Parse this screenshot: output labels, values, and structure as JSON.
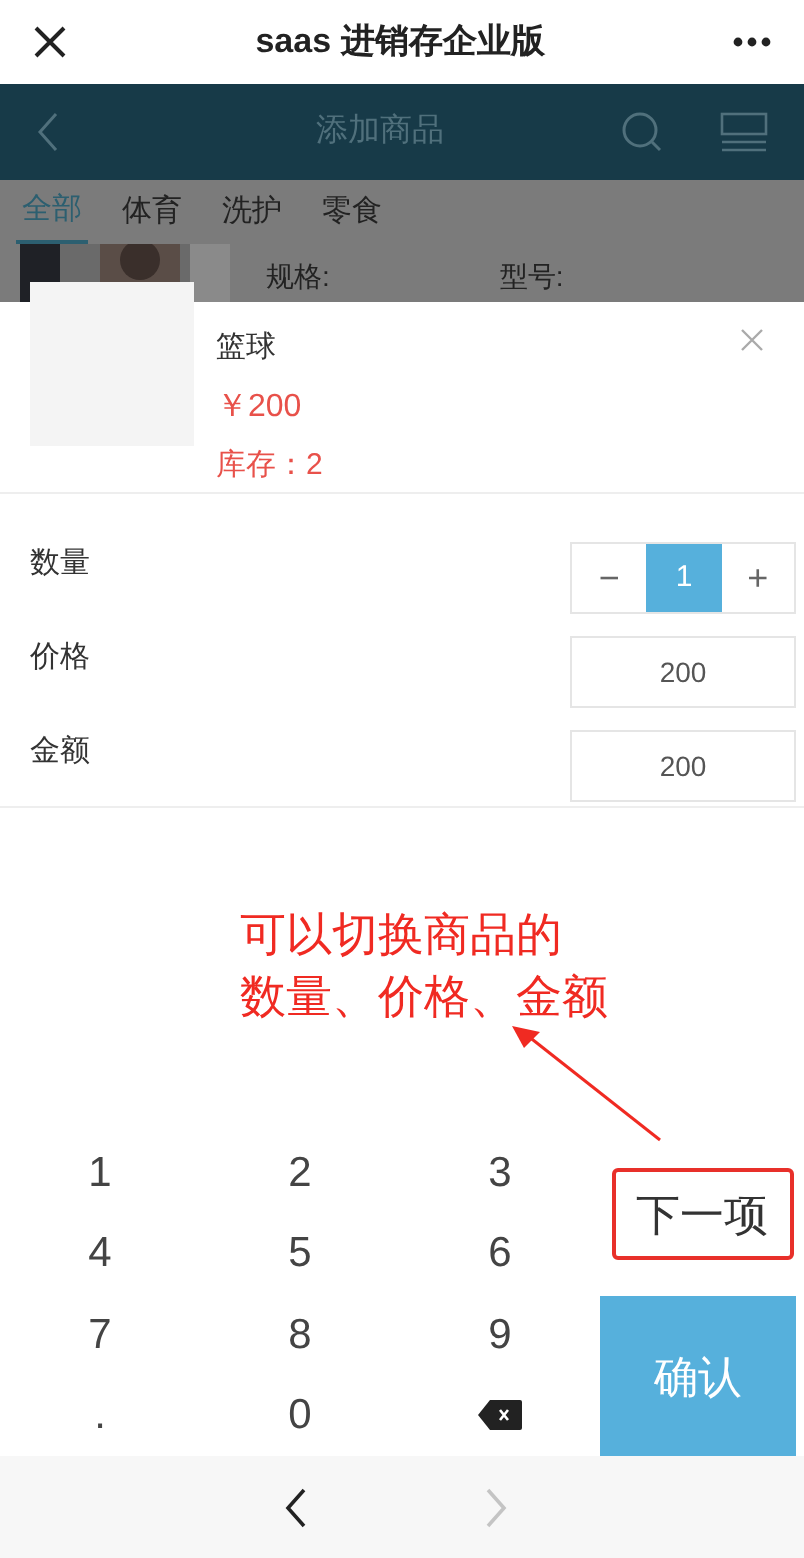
{
  "top_bar": {
    "title": "saas 进销存企业版"
  },
  "app_header": {
    "title": "添加商品"
  },
  "categories": [
    {
      "label": "全部",
      "selected": true
    },
    {
      "label": "体育",
      "selected": false
    },
    {
      "label": "洗护",
      "selected": false
    },
    {
      "label": "零食",
      "selected": false
    }
  ],
  "behind_item": {
    "spec_label": "规格:",
    "model_label": "型号:"
  },
  "product": {
    "name": "篮球",
    "price": "￥200",
    "stock": "库存：2"
  },
  "fields": [
    {
      "kind": "stepper",
      "label": "数量",
      "value": "1",
      "minus": "−",
      "plus": "+",
      "selected": true
    },
    {
      "kind": "input",
      "label": "价格",
      "value": "200",
      "selected": false
    },
    {
      "kind": "input",
      "label": "金额",
      "value": "200",
      "selected": false
    }
  ],
  "annotation": {
    "lines": [
      "可以切换商品的",
      "数量、价格、金额"
    ]
  },
  "keypad": {
    "keys": [
      "1",
      "2",
      "3",
      "4",
      "5",
      "6",
      "7",
      "8",
      "9",
      ".",
      "0"
    ],
    "next": "下一项",
    "confirm": "确认"
  },
  "nav": {
    "back_disabled": false,
    "forward_disabled": true
  }
}
